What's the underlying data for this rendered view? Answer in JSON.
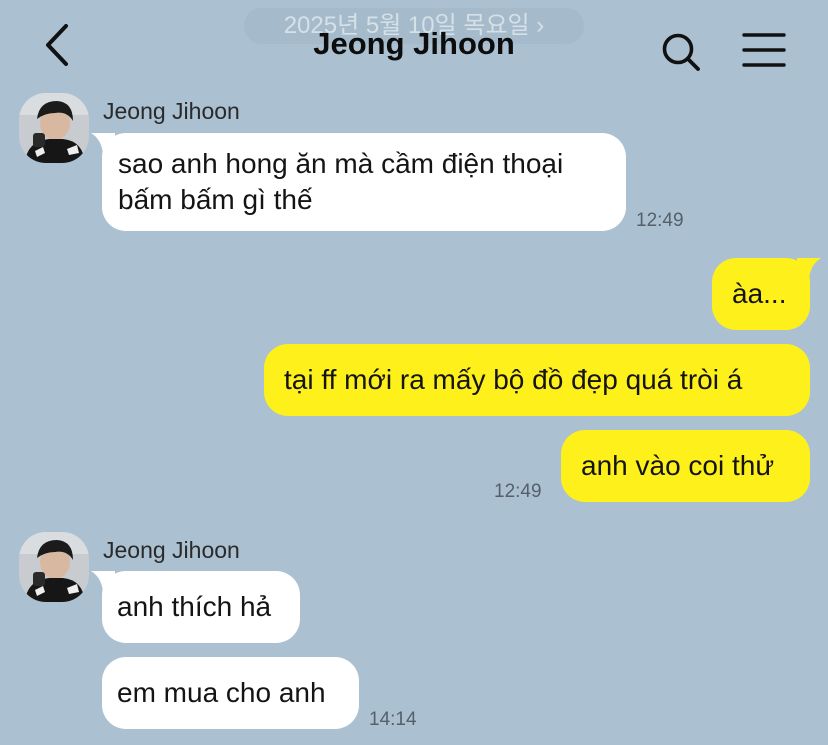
{
  "header": {
    "title": "Jeong Jihoon",
    "date_banner": "2025년 5월 10일 목요일 ›",
    "back_icon": "chevron-left-icon",
    "search_icon": "search-icon",
    "menu_icon": "hamburger-menu-icon"
  },
  "colors": {
    "background": "#abc1d1",
    "incoming_bubble": "#ffffff",
    "outgoing_bubble": "#fef01b"
  },
  "messages": {
    "group1": {
      "sender": "Jeong Jihoon",
      "bubble1": "sao anh hong ăn mà cầm điện thoại",
      "bubble1_line2": "bấm bấm gì thế",
      "time": "12:49"
    },
    "outgoing": {
      "bubble1": "àa...",
      "bubble2": "tại ff mới ra mấy bộ đồ đẹp quá tròi á",
      "bubble3": "anh vào coi thử",
      "time": "12:49"
    },
    "group2": {
      "sender": "Jeong Jihoon",
      "bubble1": "anh thích hả",
      "bubble2": "em mua cho anh",
      "time": "14:14"
    }
  }
}
